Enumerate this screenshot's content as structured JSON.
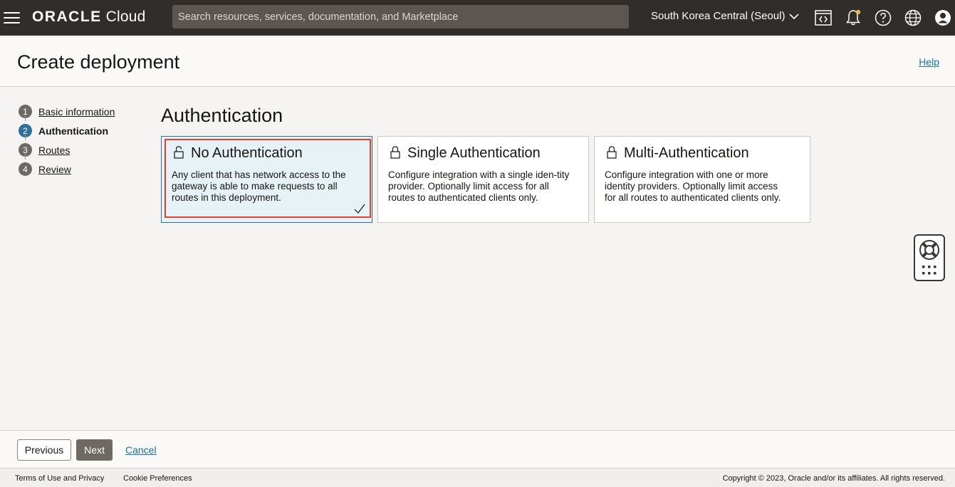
{
  "topbar": {
    "brand_bold": "ORACLE",
    "brand_light": "Cloud",
    "search_placeholder": "Search resources, services, documentation, and Marketplace",
    "region": "South Korea Central (Seoul)"
  },
  "header": {
    "title": "Create deployment",
    "help": "Help"
  },
  "steps": [
    {
      "num": "1",
      "label": "Basic information",
      "active": false
    },
    {
      "num": "2",
      "label": "Authentication",
      "active": true
    },
    {
      "num": "3",
      "label": "Routes",
      "active": false
    },
    {
      "num": "4",
      "label": "Review",
      "active": false
    }
  ],
  "main": {
    "title": "Authentication",
    "cards": [
      {
        "title": "No Authentication",
        "description": "Any client that has network access to the gateway is able to make requests to all routes in this deployment.",
        "selected": true
      },
      {
        "title": "Single Authentication",
        "description": "Configure integration with a single iden-tity provider. Optionally limit access for all routes to authenticated clients only.",
        "selected": false
      },
      {
        "title": "Multi-Authentication",
        "description": "Configure integration with one or more identity providers. Optionally limit access for all routes to authenticated clients only.",
        "selected": false
      }
    ]
  },
  "actions": {
    "previous": "Previous",
    "next": "Next",
    "cancel": "Cancel"
  },
  "footer": {
    "terms": "Terms of Use and Privacy",
    "cookies": "Cookie Preferences",
    "copyright": "Copyright © 2023, Oracle and/or its affiliates. All rights reserved."
  },
  "colors": {
    "topbar": "#312d2a",
    "link": "#1a6fa3",
    "active_step": "#2f6f9a",
    "selected_card_bg": "#e6f2f5",
    "highlight_border": "#e2412f"
  },
  "icons": [
    "hamburger-menu-icon",
    "chevron-down-icon",
    "code-editor-icon",
    "notification-bell-icon",
    "help-circle-icon",
    "globe-language-icon",
    "user-profile-icon",
    "lock-icon",
    "checkmark-icon",
    "lifebuoy-icon",
    "apps-grid-icon"
  ]
}
